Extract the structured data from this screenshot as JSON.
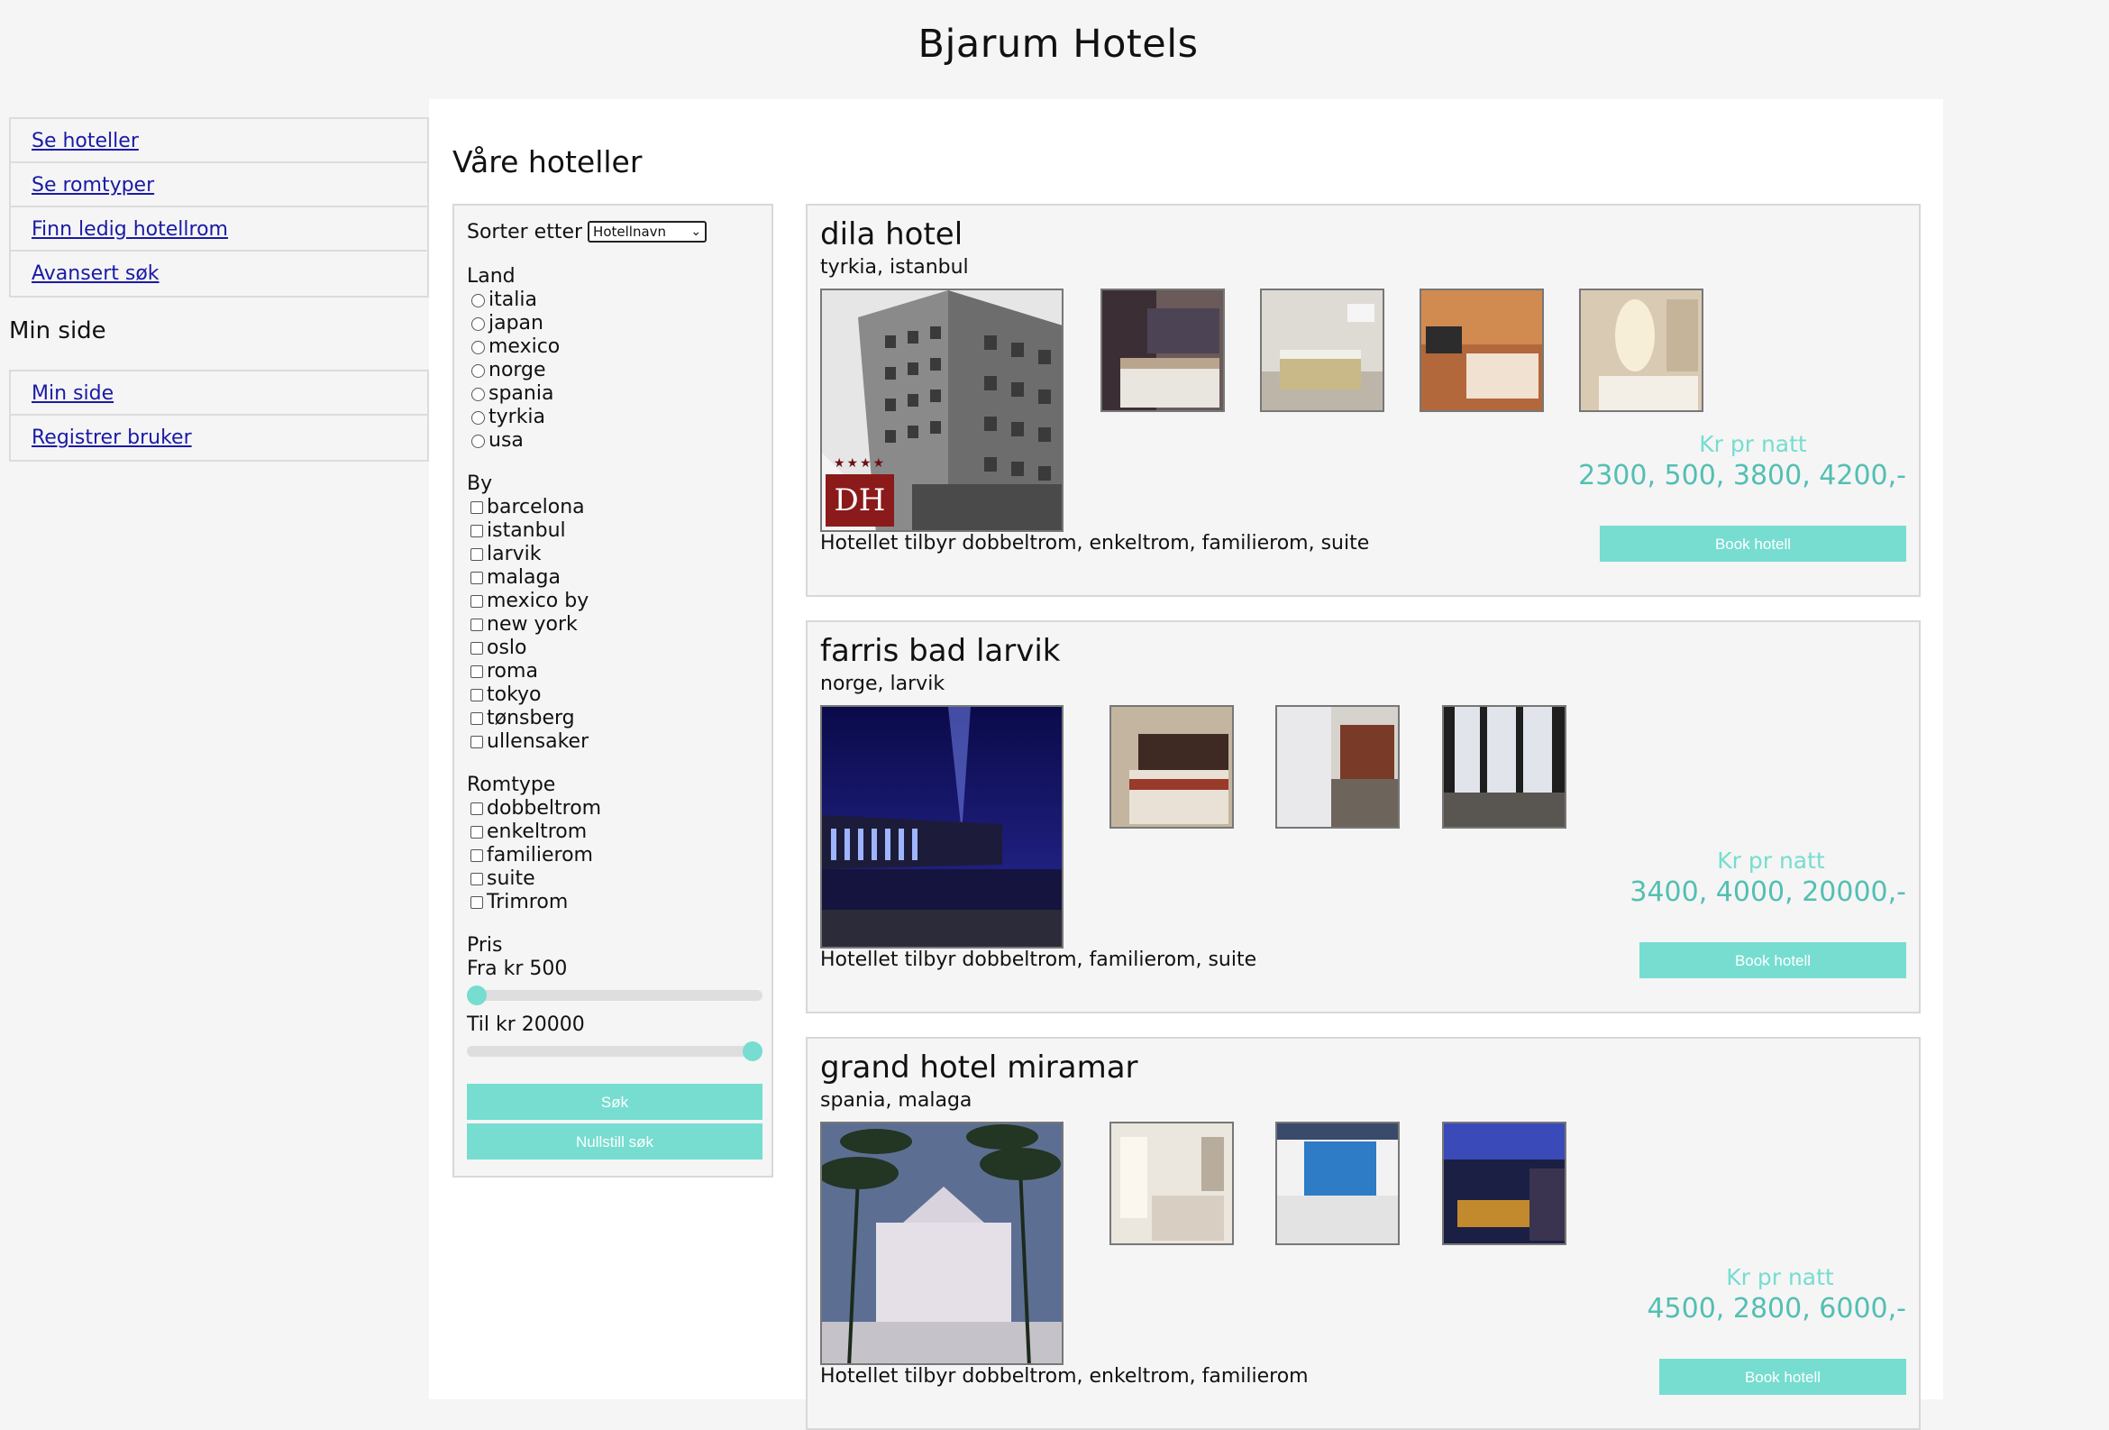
{
  "site": {
    "title": "Bjarum Hotels"
  },
  "nav": {
    "main_items": [
      {
        "label": "Se hoteller"
      },
      {
        "label": "Se romtyper"
      },
      {
        "label": "Finn ledig hotellrom"
      },
      {
        "label": "Avansert søk"
      }
    ],
    "user_heading": "Min side",
    "user_items": [
      {
        "label": "Min side"
      },
      {
        "label": "Registrer bruker"
      }
    ]
  },
  "main": {
    "title": "Våre hoteller"
  },
  "filter": {
    "sort_label": "Sorter etter",
    "sort_value": "Hotellnavn",
    "land_title": "Land",
    "land": [
      "italia",
      "japan",
      "mexico",
      "norge",
      "spania",
      "tyrkia",
      "usa"
    ],
    "by_title": "By",
    "by": [
      "barcelona",
      "istanbul",
      "larvik",
      "malaga",
      "mexico by",
      "new york",
      "oslo",
      "roma",
      "tokyo",
      "tønsberg",
      "ullensaker"
    ],
    "romtype_title": "Romtype",
    "romtype": [
      "dobbeltrom",
      "enkeltrom",
      "familierom",
      "suite",
      "Trimrom"
    ],
    "pris_title": "Pris",
    "fra_label": "Fra kr 500",
    "til_label": "Til kr 20000",
    "price_min": 500,
    "price_max": 20000,
    "fra_value": 500,
    "til_value": 20000,
    "search_button": "Søk",
    "reset_button": "Nullstill søk"
  },
  "hotels": [
    {
      "name": "dila hotel",
      "location": "tyrkia, istanbul",
      "description": "Hotellet tilbyr dobbeltrom, enkeltrom, familierom, suite",
      "price_label": "Kr pr natt",
      "prices": "2300, 500, 3800, 4200,-",
      "book_label": "Book hotell",
      "logo_text": "DH",
      "stars": "★★★★"
    },
    {
      "name": "farris bad larvik",
      "location": "norge, larvik",
      "description": "Hotellet tilbyr dobbeltrom, familierom, suite",
      "price_label": "Kr pr natt",
      "prices": "3400, 4000, 20000,-",
      "book_label": "Book hotell"
    },
    {
      "name": "grand hotel miramar",
      "location": "spania, malaga",
      "description": "Hotellet tilbyr dobbeltrom, enkeltrom, familierom",
      "price_label": "Kr pr natt",
      "prices": "4500, 2800, 6000,-",
      "book_label": "Book hotell"
    }
  ],
  "colors": {
    "accent": "#76ddd0",
    "price_text": "#53bfb2",
    "link": "#1a1aa6"
  }
}
